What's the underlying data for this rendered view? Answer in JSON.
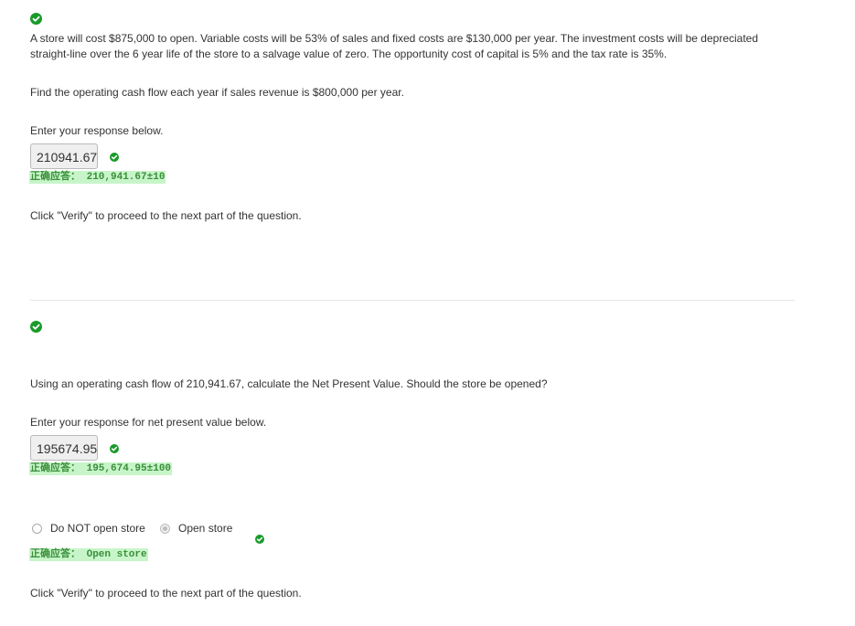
{
  "colors": {
    "check": "#1a9a2a",
    "answer_bg": "#c7f5c9",
    "answer_text": "#3a8f3a",
    "text": "#333333"
  },
  "part1": {
    "status_icon": "check-circle-icon",
    "problem_line1": "A store will cost $875,000 to open. Variable costs will be 53% of sales and fixed costs are $130,000 per year. The investment costs will be depreciated",
    "problem_line2": "straight-line over the 6 year life of the store to a salvage value of zero. The opportunity cost of capital is 5% and the tax rate is 35%.",
    "question": "Find the operating cash flow each year if sales revenue is $800,000 per year.",
    "prompt": "Enter your response below.",
    "input_value": "210941.67",
    "correct_answer": "正确应答： 210,941.67±10",
    "footer": "Click \"Verify\" to proceed to the next part of the question."
  },
  "part2": {
    "status_icon": "check-circle-icon",
    "question": "Using an operating cash flow of 210,941.67, calculate the Net Present Value. Should the store be opened?",
    "prompt": "Enter your response for net present value below.",
    "input_value": "195674.95",
    "correct_answer": "正确应答： 195,674.95±100",
    "options": [
      {
        "label": "Do NOT open store",
        "selected": false
      },
      {
        "label": "Open store",
        "selected": true
      }
    ],
    "choice_answer": "正确应答： Open store",
    "footer": "Click \"Verify\" to proceed to the next part of the question."
  }
}
